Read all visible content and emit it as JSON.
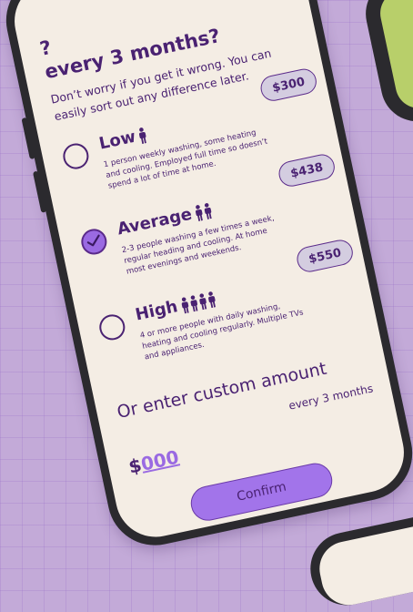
{
  "heading": "?\nevery 3 months?",
  "subtitle": "Don’t worry if you get it wrong. You can easily sort out any difference later.",
  "options": [
    {
      "title": "Low",
      "people_icon": "person-icon",
      "people_count": 1,
      "description": "1 person weekly washing, some heating and cooling. Employed full time so doesn’t spend a lot of time at home.",
      "price": "$300",
      "selected": false
    },
    {
      "title": "Average",
      "people_icon": "person-icon",
      "people_count": 2,
      "description": "2-3 people washing a few times a week, regular heading and cooling. At home most evenings and weekends.",
      "price": "$438",
      "selected": true
    },
    {
      "title": "High",
      "people_icon": "person-icon",
      "people_count": 4,
      "description": "4 or more people with daily washing, heating and cooling regularly. Multiple TVs and appliances.",
      "price": "$550",
      "selected": false
    }
  ],
  "custom": {
    "title": "Or enter custom amount",
    "period": "every 3 months",
    "currency": "$",
    "amount": "000"
  },
  "confirm_label": "Confirm",
  "colors": {
    "background": "#c3aad8",
    "screen": "#f4ede4",
    "text": "#4a2272",
    "accent": "#a274ea",
    "price_pill": "#d4cde0"
  }
}
